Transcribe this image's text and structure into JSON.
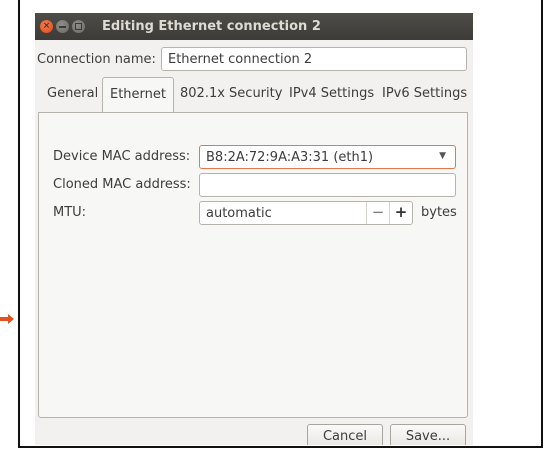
{
  "window": {
    "title": "Editing Ethernet connection 2",
    "close_glyph": "×"
  },
  "connection": {
    "label": "Connection name:",
    "value": "Ethernet connection 2"
  },
  "tabs": [
    {
      "label": "General"
    },
    {
      "label": "Ethernet",
      "active": true
    },
    {
      "label": "802.1x Security"
    },
    {
      "label": "IPv4 Settings"
    },
    {
      "label": "IPv6 Settings"
    }
  ],
  "ethernet": {
    "device_mac": {
      "label": "Device MAC address:",
      "value": "B8:2A:72:9A:A3:31 (eth1)",
      "dropdown_glyph": "▼"
    },
    "cloned_mac": {
      "label": "Cloned MAC address:",
      "value": ""
    },
    "mtu": {
      "label": "MTU:",
      "value": "automatic",
      "minus": "−",
      "plus": "+",
      "units": "bytes"
    }
  },
  "buttons": {
    "cancel": "Cancel",
    "save": "Save..."
  },
  "colors": {
    "titlebar": "#3c3b37",
    "close": "#df4a16",
    "focus_border": "#e6764b",
    "arrow": "#e0531e"
  },
  "icons": [
    "close-icon",
    "minimize-icon",
    "maximize-icon",
    "chevron-down-icon",
    "arrow-icon"
  ]
}
